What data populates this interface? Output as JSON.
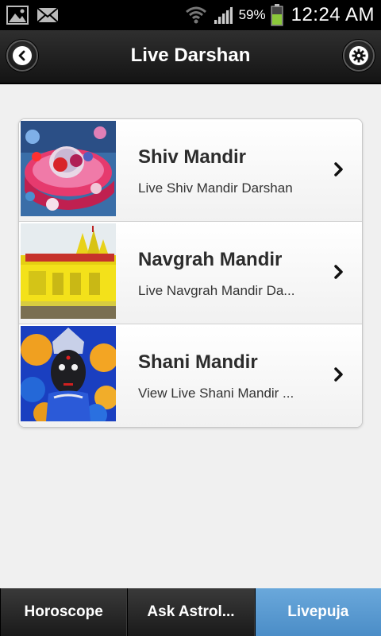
{
  "status_bar": {
    "left_icons": [
      "image-icon",
      "mail-icon"
    ],
    "right_icons": [
      "wifi-icon",
      "signal-icon",
      "battery-icon"
    ],
    "battery_percent": "59%",
    "time": "12:24 AM"
  },
  "header": {
    "title": "Live Darshan",
    "back_icon": "back-arrow-icon",
    "settings_icon": "gear-icon"
  },
  "list": {
    "items": [
      {
        "title": "Shiv Mandir",
        "subtitle": "Live Shiv Mandir Darshan",
        "thumbnail": "shiv-mandir-thumbnail",
        "arrow_icon": "chevron-right-icon"
      },
      {
        "title": "Navgrah Mandir",
        "subtitle": "Live Navgrah Mandir Da...",
        "thumbnail": "navgrah-mandir-thumbnail",
        "arrow_icon": "chevron-right-icon"
      },
      {
        "title": "Shani Mandir",
        "subtitle": "View Live Shani Mandir ...",
        "thumbnail": "shani-mandir-thumbnail",
        "arrow_icon": "chevron-right-icon"
      }
    ]
  },
  "tabs": [
    {
      "label": "Horoscope",
      "active": false
    },
    {
      "label": "Ask Astrol...",
      "active": false
    },
    {
      "label": "Livepuja",
      "active": true
    }
  ],
  "colors": {
    "header_bg": "#1e1e1e",
    "active_tab": "#5a9ad3",
    "page_bg": "#f0f0f0"
  }
}
